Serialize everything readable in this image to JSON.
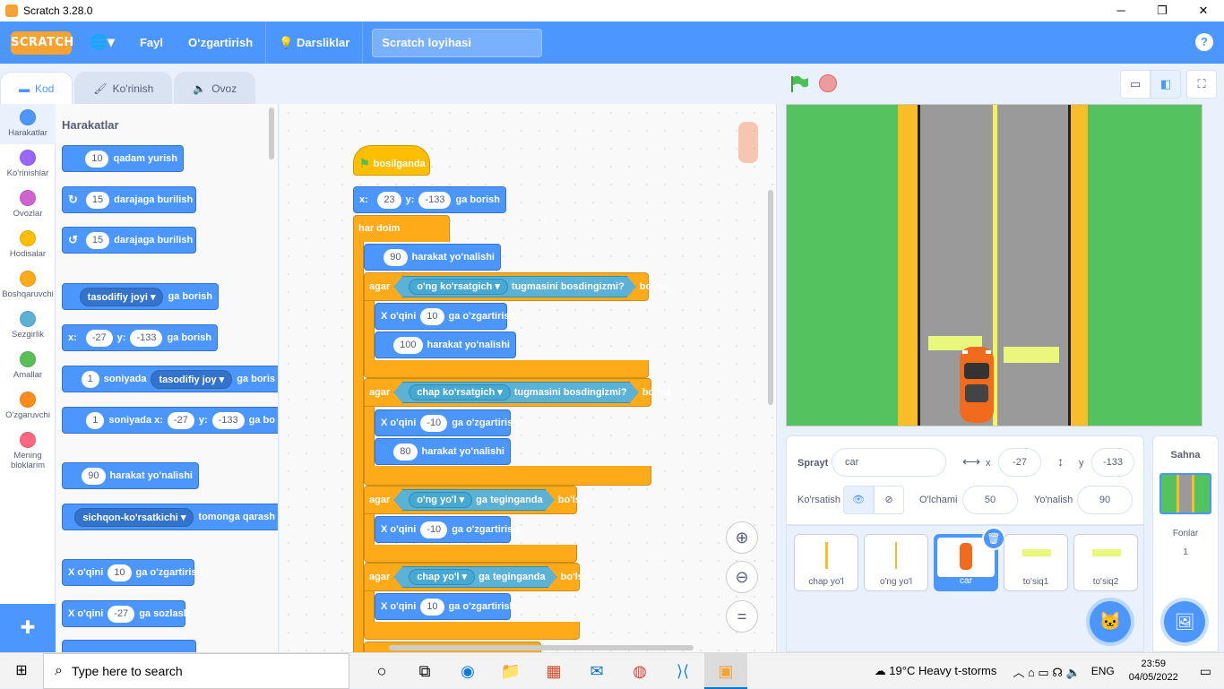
{
  "window": {
    "title": "Scratch 3.28.0",
    "minimize": "─",
    "maximize": "❐",
    "close": "✕"
  },
  "menubar": {
    "logo": "SCRATCH",
    "globe_icon": "🌐▾",
    "file": "Fayl",
    "edit": "O‘zgartirish",
    "tutorials": "Darsliklar",
    "project_title": "Scratch loyihasi",
    "help": "?"
  },
  "tabs": [
    {
      "icon": "▬",
      "label": "Kod"
    },
    {
      "icon": "🖌",
      "label": "Ko'rinish"
    },
    {
      "icon": "🔈",
      "label": "Ovoz"
    }
  ],
  "categories": [
    {
      "label": "Harakatlar",
      "color": "#4c97ff"
    },
    {
      "label": "Ko'rinishlar",
      "color": "#9966ff"
    },
    {
      "label": "Ovozlar",
      "color": "#cf63cf"
    },
    {
      "label": "Hodisalar",
      "color": "#ffbf00"
    },
    {
      "label": "Boshqaruvchi",
      "color": "#ffab19"
    },
    {
      "label": "Sezgirlik",
      "color": "#5cb1d6"
    },
    {
      "label": "Amallar",
      "color": "#59c059"
    },
    {
      "label": "O'zgaruvchi",
      "color": "#ff8c1a"
    },
    {
      "label": "Mening bloklarim",
      "color": "#ff6680"
    }
  ],
  "palette": {
    "heading": "Harakatlar",
    "move": {
      "n": "10",
      "t": "qadam yurish"
    },
    "turn_right": {
      "n": "15",
      "t": "darajaga burilish"
    },
    "turn_left": {
      "n": "15",
      "t": "darajaga burilish"
    },
    "goto": {
      "dd": "tasodifiy joyi ▾",
      "t": "ga borish"
    },
    "gotoxy": {
      "x": "x:",
      "xv": "-27",
      "y": "y:",
      "yv": "-133",
      "t": "ga borish"
    },
    "glide": {
      "n": "1",
      "t1": "soniyada",
      "dd": "tasodifiy joy ▾",
      "t2": "ga boris"
    },
    "glidexy": {
      "n": "1",
      "t1": "soniyada x:",
      "xv": "-27",
      "y": "y:",
      "yv": "-133",
      "t2": "ga bo"
    },
    "point": {
      "n": "90",
      "t": "harakat yo'nalishi"
    },
    "pointto": {
      "dd": "sichqon-ko'rsatkichi ▾",
      "t": "tomonga qarash"
    },
    "changex": {
      "t1": "X o'qini",
      "n": "10",
      "t2": "ga o'zgartirish"
    },
    "setx": {
      "t1": "X o'qini",
      "n": "-27",
      "t2": "ga sozlash"
    }
  },
  "script": {
    "hat": "bosilganda",
    "gotoxy": {
      "x": "x:",
      "xv": "23",
      "y": "y:",
      "yv": "-133",
      "t": "ga borish"
    },
    "forever": "har doim",
    "point1": {
      "n": "90",
      "t": "harakat yo'nalishi"
    },
    "if1": {
      "agar": "agar",
      "key": "o'ng ko'rsatgich ▾",
      "t": "tugmasini bosdingizmi?",
      "bolsa": "bo'lsa"
    },
    "change1": {
      "t1": "X o'qini",
      "n": "10",
      "t2": "ga o'zgartirish"
    },
    "point2": {
      "n": "100",
      "t": "harakat yo'nalishi"
    },
    "if2": {
      "agar": "agar",
      "key": "chap ko'rsatgich ▾",
      "t": "tugmasini bosdingizmi?",
      "bolsa": "bo'lsa"
    },
    "change2": {
      "t1": "X o'qini",
      "n": "-10",
      "t2": "ga o'zgartirish"
    },
    "point3": {
      "n": "80",
      "t": "harakat yo'nalishi"
    },
    "if3": {
      "agar": "agar",
      "obj": "o'ng yo'l ▾",
      "t": "ga teginganda",
      "bolsa": "bo'lsa"
    },
    "change3": {
      "t1": "X o'qini",
      "n": "-10",
      "t2": "ga o'zgartirish"
    },
    "if4": {
      "agar": "agar",
      "obj": "chap yo'l ▾",
      "t": "ga teginganda",
      "bolsa": "bo'lsa"
    },
    "change4": {
      "t1": "X o'qini",
      "n": "10",
      "t2": "ga o'zgartirish"
    }
  },
  "zoom": {
    "in": "⊕",
    "out": "⊖",
    "reset": "="
  },
  "stage_controls": {
    "small": "▭",
    "normal": "◧",
    "full": "⛶"
  },
  "sprite_info": {
    "sprite_label": "Sprayt",
    "sprite_name": "car",
    "x_icon": "⟷",
    "x_label": "x",
    "x": "-27",
    "y_icon": "↕",
    "y_label": "y",
    "y": "-133",
    "show_label": "Ko'rsatish",
    "show_icon": "👁",
    "hide_icon": "⊘",
    "size_label": "O'lchami",
    "size": "50",
    "direction_label": "Yo'nalish",
    "direction": "90"
  },
  "sprites": [
    {
      "name": "chap yo'l"
    },
    {
      "name": "o'ng yo'l"
    },
    {
      "name": "car"
    },
    {
      "name": "to'siq1"
    },
    {
      "name": "to'siq2"
    }
  ],
  "delete_icon": "🗑",
  "add_sprite_icon": "🐱",
  "stage_panel": {
    "title": "Sahna",
    "backdrops_label": "Fonlar",
    "backdrops_count": "1",
    "add_icon": "🖼"
  },
  "taskbar": {
    "start_icon": "⊞",
    "search_icon": "⌕",
    "search_placeholder": "Type here to search",
    "apps": [
      "○",
      "⧉",
      "◉",
      "📁",
      "▦",
      "✉",
      "◍",
      "⟩⟨",
      "▣"
    ],
    "weather": "☁ 19°C  Heavy t-storms",
    "tray_icons": "︿ ⌂ ▭ ☊ 🔈",
    "lang": "ENG",
    "time": "23:59",
    "date": "04/05/2022",
    "notif": "▭"
  }
}
